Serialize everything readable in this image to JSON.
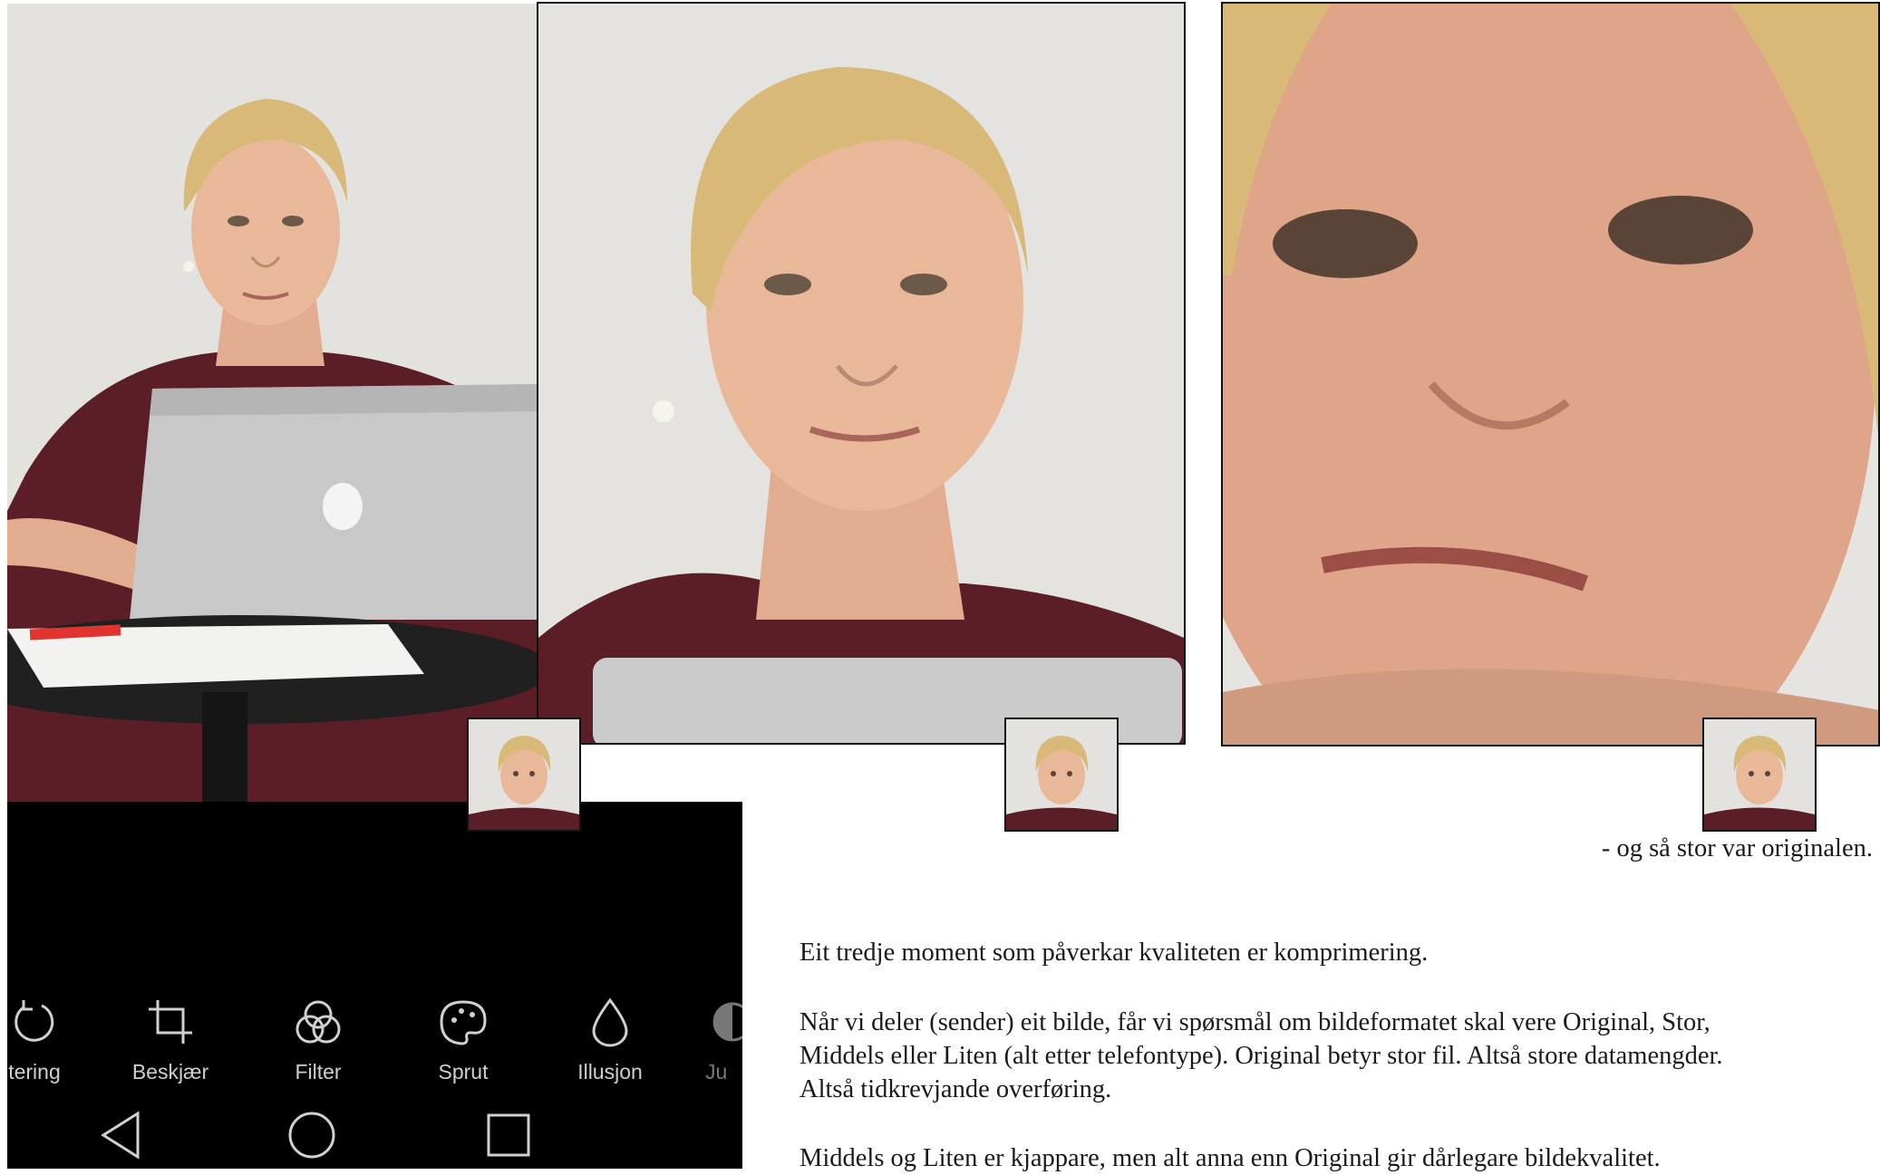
{
  "caption_original": "- og så stor var originalen.",
  "paragraphs": [
    "Eit tredje moment som påverkar kvaliteten er komprimering.",
    "Når vi deler (sender) eit bilde, får vi spørsmål om bildeformatet skal vere Original, Stor,",
    "Middels eller Liten (alt etter telefontype). Original betyr stor fil. Altså store datamengder.",
    "Altså tidkrevjande overføring.",
    "Middels og Liten er kjappare, men alt anna enn Original gir dårlegare bildekvalitet."
  ],
  "editor_toolbar": {
    "tools": [
      {
        "label": "tering",
        "icon": "rotate-icon"
      },
      {
        "label": "Beskjær",
        "icon": "crop-icon"
      },
      {
        "label": "Filter",
        "icon": "filter-icon"
      },
      {
        "label": "Sprut",
        "icon": "palette-icon"
      },
      {
        "label": "Illusjon",
        "icon": "drop-icon"
      },
      {
        "label": "Ju",
        "icon": "adjust-icon"
      }
    ],
    "nav": [
      {
        "icon": "back-triangle-icon"
      },
      {
        "icon": "home-circle-icon"
      },
      {
        "icon": "recents-square-icon"
      }
    ]
  },
  "colors": {
    "wall": "#e3e2df",
    "hair": "#d8b978",
    "skin": "#e4b194",
    "shirt": "#5b1e26",
    "laptop": "#cfcfcf",
    "table": "#202020",
    "toolbar_bg": "#000000",
    "toolbar_text": "#cfcfcf"
  }
}
